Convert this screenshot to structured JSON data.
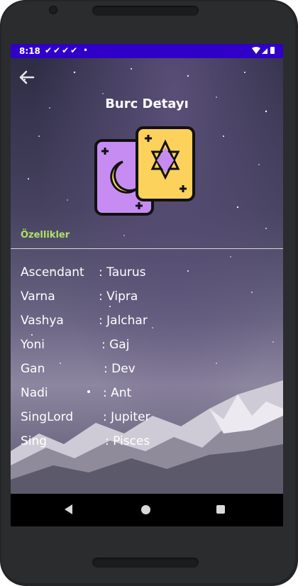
{
  "status": {
    "time": "8:18",
    "notifications": "✔✔✔✔ •"
  },
  "header": {
    "back": "back-arrow-icon",
    "title": "Burc Detayı"
  },
  "section": {
    "label": "Özellikler"
  },
  "attributes": [
    {
      "key": "Ascendant",
      "value": ": Taurus"
    },
    {
      "key": "Varna",
      "value": ": Vipra"
    },
    {
      "key": "Vashya",
      "value": ": Jalchar"
    },
    {
      "key": "Yoni",
      "value": ": Gaj"
    },
    {
      "key": "Gan",
      "value": ": Dev"
    },
    {
      "key": "Nadi",
      "value": ": Ant"
    },
    {
      "key": "SingLord",
      "value": ": Jupiter"
    },
    {
      "key": "Sing",
      "value": ": Pisces"
    }
  ],
  "nav": {
    "back": "nav-back-icon",
    "home": "nav-home-icon",
    "recent": "nav-recent-icon"
  },
  "colors": {
    "status_bar": "#3000c8",
    "accent_label": "#b2e06a",
    "card_purple": "#c78cf2",
    "card_yellow": "#fdd25c"
  }
}
